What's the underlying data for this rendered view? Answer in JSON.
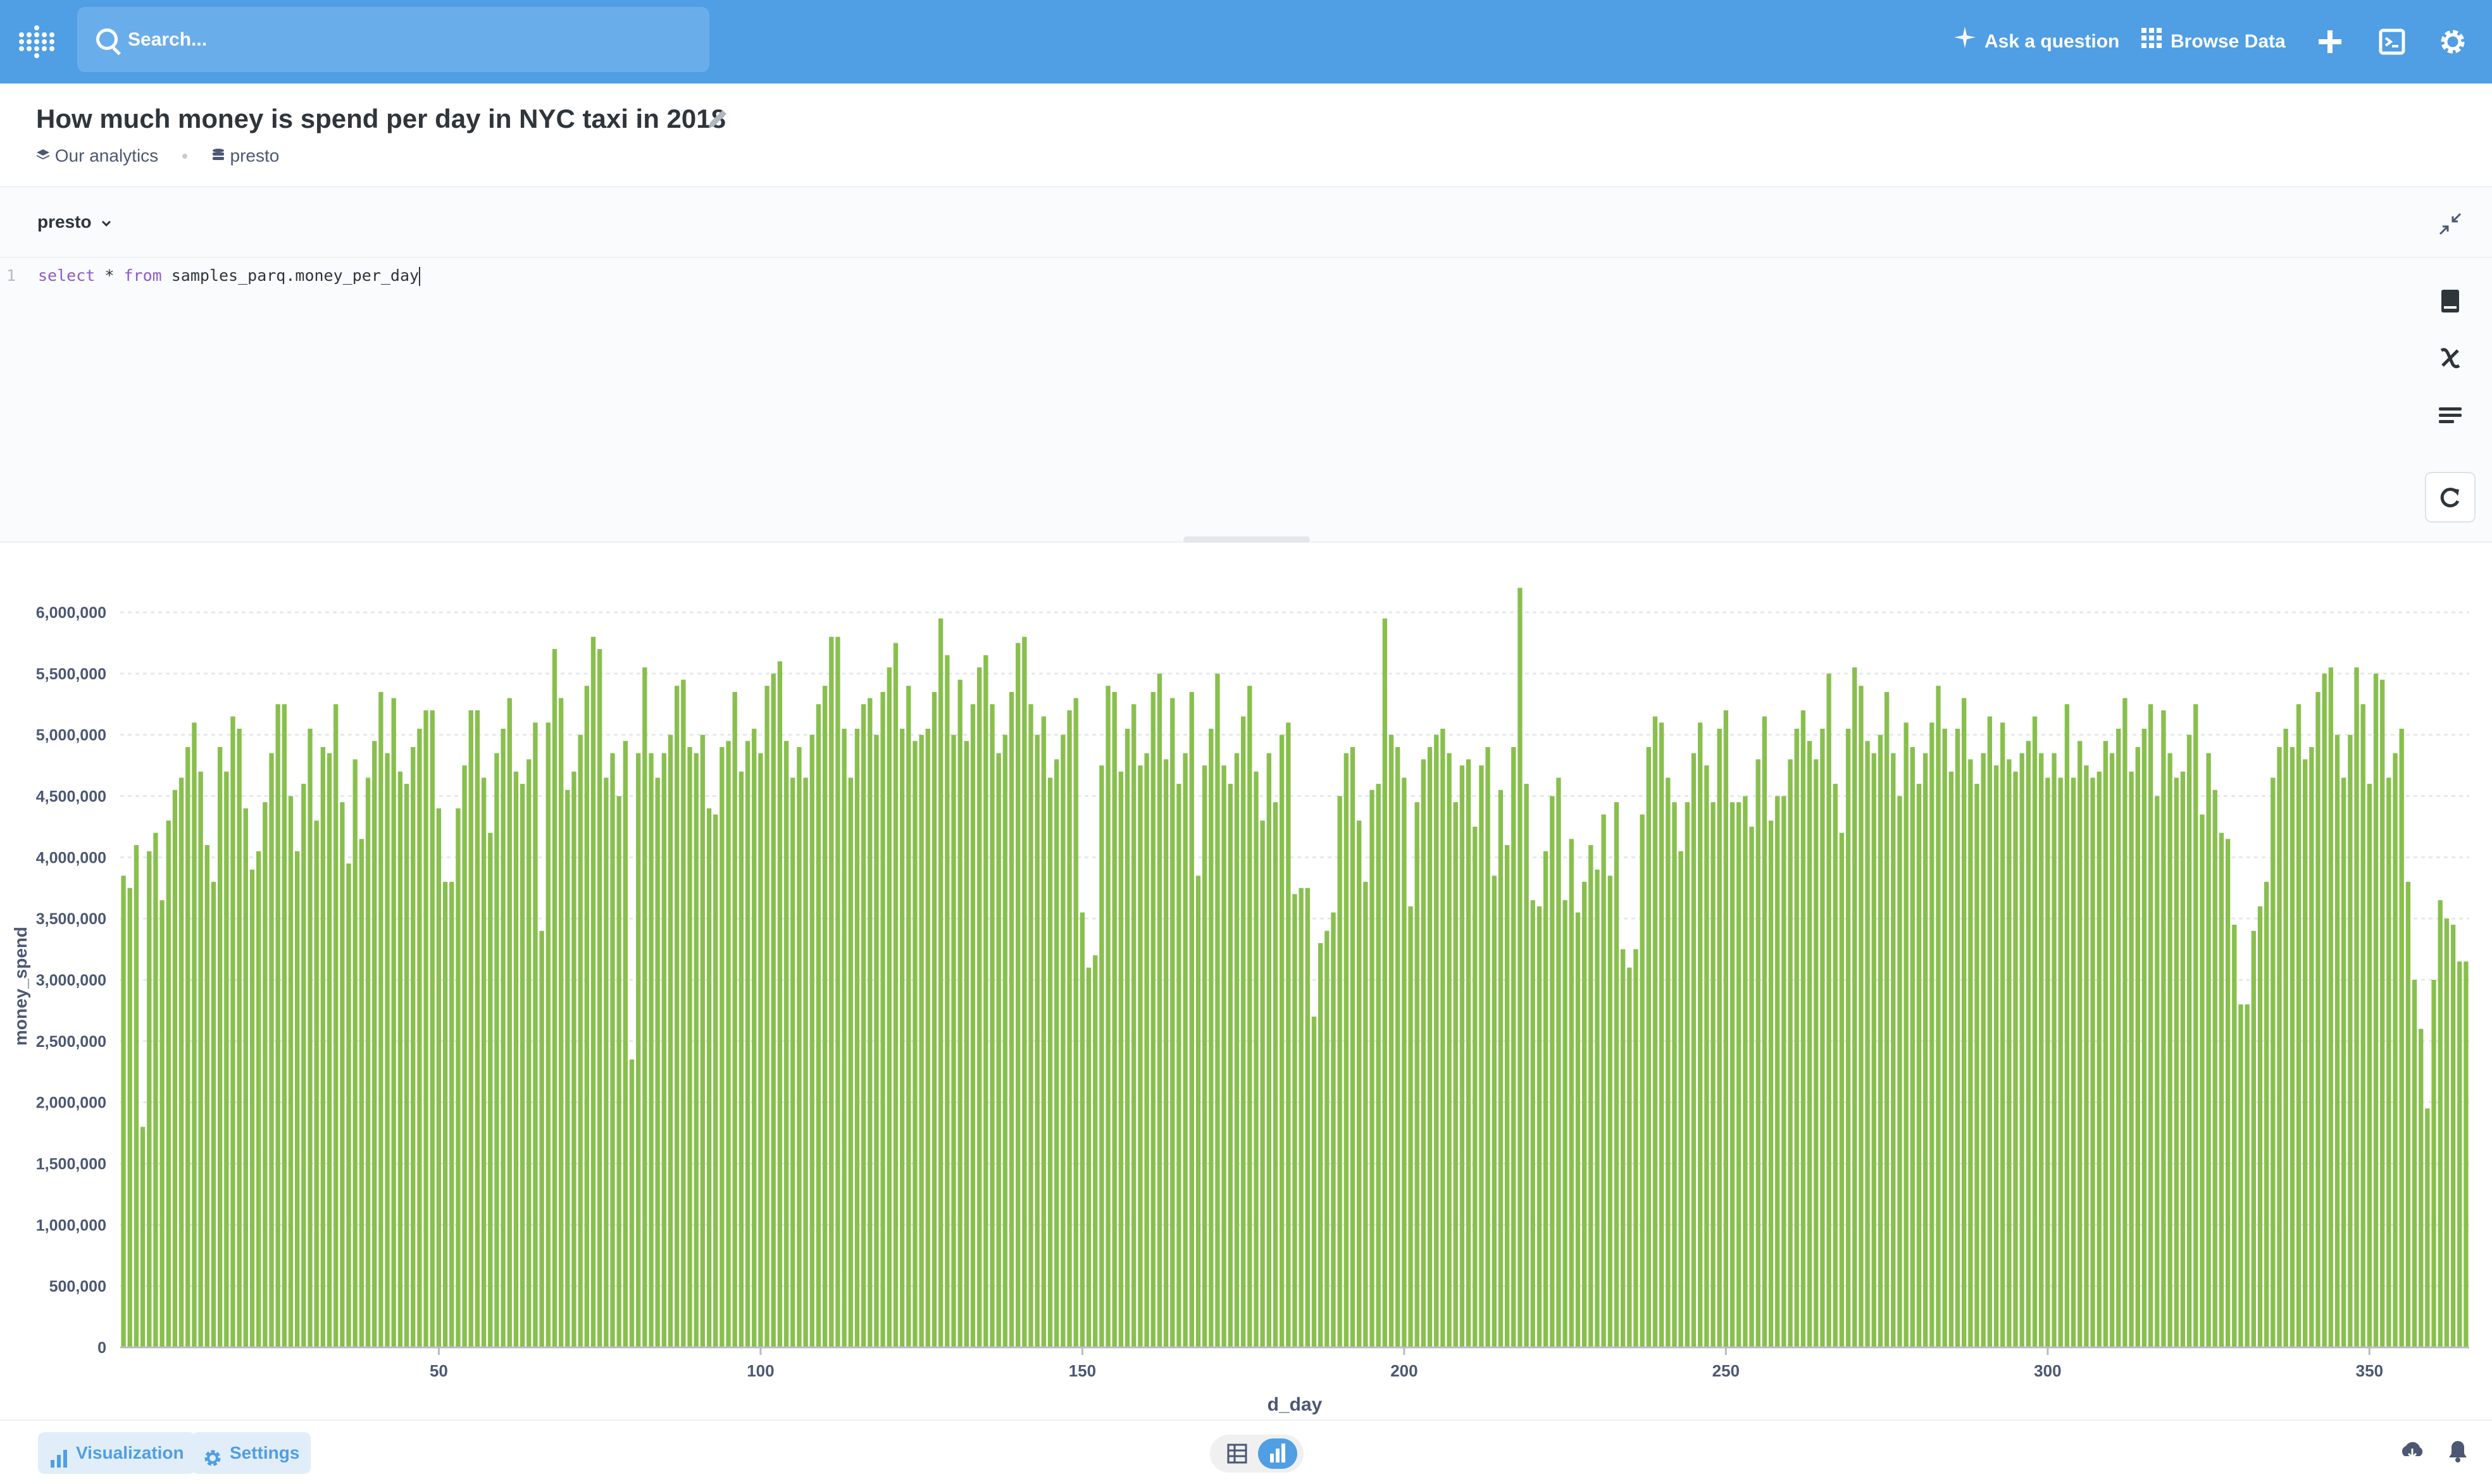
{
  "nav": {
    "search_placeholder": "Search...",
    "ask_label": "Ask a question",
    "browse_label": "Browse Data",
    "accent_color": "#509ee3"
  },
  "question": {
    "title": "How much money is spend per day in NYC taxi in 2018",
    "collection": "Our analytics",
    "database": "presto"
  },
  "editor": {
    "db_selector": "presto",
    "line_number": "1",
    "kw_select": "select",
    "star": " * ",
    "kw_from": "from",
    "table": " samples_parq.money_per_day"
  },
  "footer": {
    "visualization_label": "Visualization",
    "settings_label": "Settings"
  },
  "icons": [
    "metabase-logo-icon",
    "search-icon",
    "sparkle-icon",
    "grid-icon",
    "plus-icon",
    "terminal-icon",
    "gear-icon",
    "pencil-icon",
    "collection-icon",
    "database-icon",
    "chevron-down-icon",
    "collapse-icon",
    "book-icon",
    "variable-icon",
    "snippet-icon",
    "refresh-icon",
    "bar-chart-icon",
    "table-icon",
    "download-icon",
    "bell-icon"
  ],
  "chart_data": {
    "type": "bar",
    "color": "#88bf4d",
    "xlabel": "d_day",
    "ylabel": "money_spend",
    "xlim": [
      1,
      365
    ],
    "ylim": [
      0,
      6000000
    ],
    "x_ticks": [
      50,
      100,
      150,
      200,
      250,
      300,
      350
    ],
    "y_ticks": [
      0,
      500000,
      1000000,
      1500000,
      2000000,
      2500000,
      3000000,
      3500000,
      4000000,
      4500000,
      5000000,
      5500000,
      6000000
    ],
    "y_tick_labels": [
      "0",
      "500,000",
      "1,000,000",
      "1,500,000",
      "2,000,000",
      "2,500,000",
      "3,000,000",
      "3,500,000",
      "4,000,000",
      "4,500,000",
      "5,000,000",
      "5,500,000",
      "6,000,000"
    ],
    "x_start": 1,
    "values": [
      3850000,
      3750000,
      4100000,
      1800000,
      4050000,
      4200000,
      3650000,
      4300000,
      4550000,
      4650000,
      4900000,
      5100000,
      4700000,
      4100000,
      3800000,
      4900000,
      4700000,
      5150000,
      5050000,
      4400000,
      3900000,
      4050000,
      4450000,
      4850000,
      5250000,
      5250000,
      4500000,
      4050000,
      4600000,
      5050000,
      4300000,
      4900000,
      4850000,
      5250000,
      4450000,
      3950000,
      4800000,
      4150000,
      4650000,
      4950000,
      5350000,
      4850000,
      5300000,
      4700000,
      4600000,
      4900000,
      5050000,
      5200000,
      5200000,
      4400000,
      3800000,
      3800000,
      4400000,
      4750000,
      5200000,
      5200000,
      4650000,
      4200000,
      4850000,
      5050000,
      5300000,
      4700000,
      4600000,
      4800000,
      5100000,
      3400000,
      5100000,
      5700000,
      5300000,
      4550000,
      4700000,
      5000000,
      5400000,
      5800000,
      5700000,
      4650000,
      4850000,
      4500000,
      4950000,
      2350000,
      4850000,
      5550000,
      4850000,
      4650000,
      4850000,
      5000000,
      5400000,
      5450000,
      4900000,
      4850000,
      5000000,
      4400000,
      4350000,
      4900000,
      4950000,
      5350000,
      4700000,
      4950000,
      5050000,
      4850000,
      5400000,
      5500000,
      5600000,
      4950000,
      4650000,
      4900000,
      4650000,
      5000000,
      5250000,
      5400000,
      5800000,
      5800000,
      5050000,
      4650000,
      5050000,
      5250000,
      5300000,
      5000000,
      5350000,
      5550000,
      5750000,
      5050000,
      5400000,
      4950000,
      5000000,
      5050000,
      5350000,
      5950000,
      5650000,
      5000000,
      5450000,
      4950000,
      5250000,
      5550000,
      5650000,
      5250000,
      4850000,
      5000000,
      5350000,
      5750000,
      5800000,
      5250000,
      5000000,
      5150000,
      4650000,
      4800000,
      5000000,
      5200000,
      5300000,
      3550000,
      3100000,
      3200000,
      4750000,
      5400000,
      5350000,
      4700000,
      5050000,
      5250000,
      4750000,
      4850000,
      5350000,
      5500000,
      4800000,
      5300000,
      4600000,
      4850000,
      5350000,
      3850000,
      4750000,
      5050000,
      5500000,
      4750000,
      4600000,
      4850000,
      5150000,
      5400000,
      4700000,
      4300000,
      4850000,
      4450000,
      5000000,
      5100000,
      3700000,
      3750000,
      3750000,
      2700000,
      3300000,
      3400000,
      3550000,
      4500000,
      4850000,
      4900000,
      4300000,
      3800000,
      4550000,
      4600000,
      5950000,
      5000000,
      4900000,
      4650000,
      3600000,
      4450000,
      4800000,
      4900000,
      5000000,
      5050000,
      4850000,
      4450000,
      4750000,
      4800000,
      4250000,
      4750000,
      4900000,
      3850000,
      4550000,
      4100000,
      4900000,
      6200000,
      4600000,
      3650000,
      3600000,
      4050000,
      4500000,
      4650000,
      3650000,
      4150000,
      3550000,
      3800000,
      4100000,
      3900000,
      4350000,
      3850000,
      4450000,
      3250000,
      3100000,
      3250000,
      4350000,
      4900000,
      5150000,
      5100000,
      4650000,
      4450000,
      4050000,
      4450000,
      4850000,
      5100000,
      4750000,
      4450000,
      5050000,
      5200000,
      4450000,
      4450000,
      4500000,
      4250000,
      4800000,
      5150000,
      4300000,
      4500000,
      4500000,
      4800000,
      5050000,
      5200000,
      4950000,
      4800000,
      5050000,
      5500000,
      4600000,
      4200000,
      5050000,
      5550000,
      5400000,
      4950000,
      4850000,
      5000000,
      5350000,
      4850000,
      4500000,
      5100000,
      4900000,
      4600000,
      4850000,
      5100000,
      5400000,
      5050000,
      4700000,
      5050000,
      5300000,
      4800000,
      4600000,
      4850000,
      5150000,
      4750000,
      5100000,
      4800000,
      4700000,
      4850000,
      4950000,
      5150000,
      4850000,
      4650000,
      4850000,
      4650000,
      5250000,
      4650000,
      4950000,
      4750000,
      4650000,
      4700000,
      4950000,
      4850000,
      5050000,
      5300000,
      4700000,
      4900000,
      5050000,
      5250000,
      4500000,
      5200000,
      4850000,
      4650000,
      4700000,
      5000000,
      5250000,
      4350000,
      4850000,
      4550000,
      4200000,
      4150000,
      3450000,
      2800000,
      2800000,
      3400000,
      3600000,
      3800000,
      4650000,
      4900000,
      5050000,
      4900000,
      5250000,
      4800000,
      4900000,
      5350000,
      5500000,
      5550000,
      5000000,
      4650000,
      5000000,
      5550000,
      5250000,
      4600000,
      5500000,
      5450000,
      4650000,
      4850000,
      5050000,
      3800000,
      3000000,
      2600000,
      1950000,
      3000000,
      3650000,
      3500000,
      3450000,
      3150000,
      3150000
    ]
  }
}
